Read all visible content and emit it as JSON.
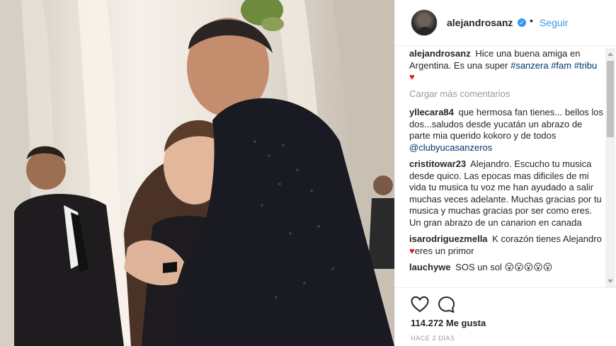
{
  "post": {
    "username": "alejandrosanz",
    "verified_mark": "✓",
    "separator": "•",
    "follow_label": "Seguir",
    "caption": {
      "username": "alejandrosanz",
      "text": "Hice una buena amiga en Argentina. Es una super ",
      "tags": [
        "#sanzera",
        "#fam",
        "#tribu"
      ],
      "heart": "♥"
    },
    "load_more_label": "Cargar más comentarios",
    "comments": [
      {
        "username": "yllecara84",
        "text": "que hermosa fan tienes... bellos los dos...saludos desde yucatán un abrazo de parte mia querido kokoro y de todos ",
        "mention": "@clubyucasanzeros"
      },
      {
        "username": "cristitowar23",
        "text": "Alejandro. Escucho tu musica desde quico. Las epocas mas dificiles de mi vida tu musica tu voz me han ayudado a salir muchas veces adelante. Muchas gracias por tu musica y muchas gracias por ser como eres. Un gran abrazo de un canarion en canada"
      },
      {
        "username": "isarodriguezmella",
        "text_before": "K corazón tienes Alejandro ",
        "heart": "♥",
        "text_after": "eres un primor"
      },
      {
        "username": "lauchywe",
        "text": "SOS un sol ",
        "emoji": "😮😮😮😮😮"
      }
    ],
    "likes_label": "114.272 Me gusta",
    "timestamp": "HACE 2 DÍAS"
  },
  "icons": {
    "like": "heart-outline-icon",
    "comment": "speech-bubble-icon",
    "verified": "verified-badge-icon"
  },
  "colors": {
    "link_blue": "#3897f0",
    "tag_blue": "#003569",
    "heart_red": "#e0182d",
    "muted_gray": "#999999"
  }
}
